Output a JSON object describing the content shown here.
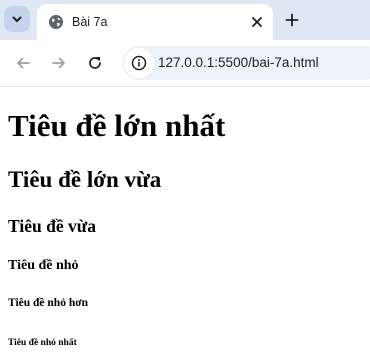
{
  "browser": {
    "tab": {
      "title": "Bài 7a",
      "favicon": "globe-icon"
    },
    "toolbar": {
      "url": "127.0.0.1:5500/bai-7a.html",
      "site_info_icon": "info-icon"
    },
    "icons": {
      "tab_search": "chevron-down-icon",
      "close": "close-icon",
      "new_tab": "plus-icon",
      "back": "arrow-left-icon",
      "forward": "arrow-right-icon",
      "reload": "reload-icon"
    },
    "colors": {
      "tabstrip": "#dfe7f5",
      "omnibox": "#edf1f8",
      "text": "#1f1f1f",
      "disabled_icon": "#9aa0a6"
    }
  },
  "page": {
    "headings": [
      {
        "level": 1,
        "text": "Tiêu đề lớn nhất"
      },
      {
        "level": 2,
        "text": "Tiêu đề lớn vừa"
      },
      {
        "level": 3,
        "text": "Tiêu đề vừa"
      },
      {
        "level": 4,
        "text": "Tiêu đề nhỏ"
      },
      {
        "level": 5,
        "text": "Tiêu đề nhỏ hơn"
      },
      {
        "level": 6,
        "text": "Tiêu đề nhỏ nhất"
      }
    ]
  }
}
